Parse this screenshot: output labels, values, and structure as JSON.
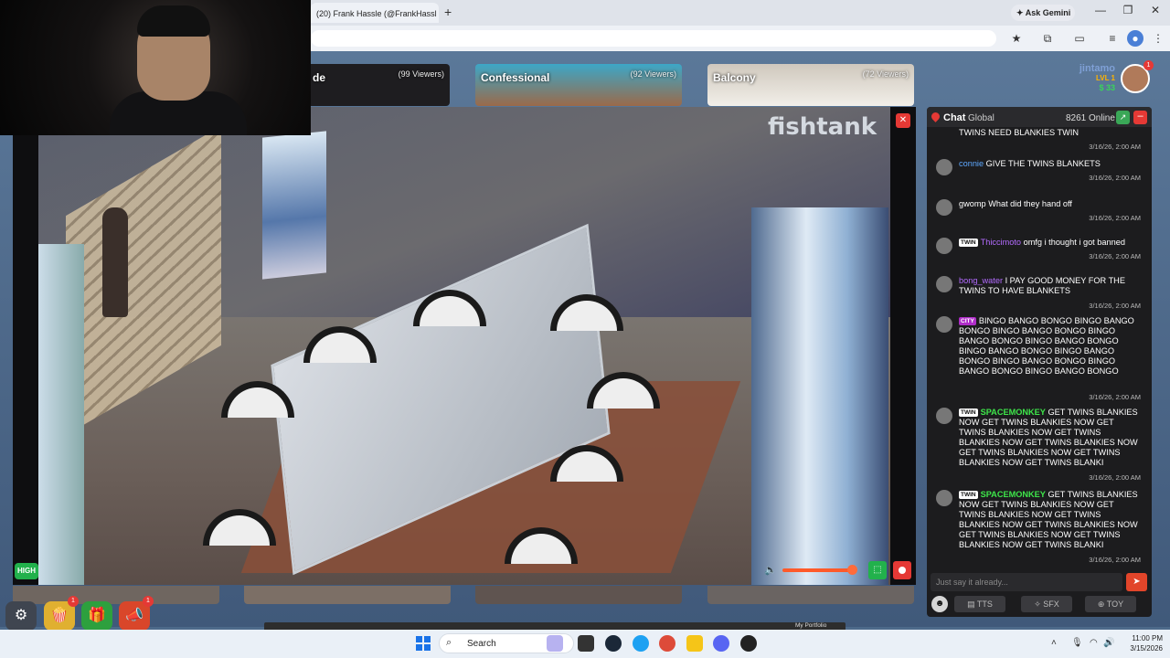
{
  "browser": {
    "tab_title": "(20) Frank Hassle (@FrankHassl",
    "new_tab": "+",
    "ask_gemini": "Ask Gemini",
    "min": "—",
    "restore": "❐",
    "close": "✕"
  },
  "rooms": [
    {
      "name": "de",
      "viewers": "(99 Viewers)"
    },
    {
      "name": "Confessional",
      "viewers": "(92 Viewers)"
    },
    {
      "name": "Balcony",
      "viewers": "(72 Viewers)"
    }
  ],
  "user": {
    "name": "jintamo",
    "level": "LVL 1",
    "coins": "$ 33",
    "badge": "1"
  },
  "video": {
    "watermark": "fishtank",
    "close": "✕",
    "quality": "HIGH",
    "volume_fraction": 0.95
  },
  "bottom_buttons": [
    {
      "icon": "gear-icon",
      "badge": ""
    },
    {
      "icon": "popcorn-icon",
      "badge": "1"
    },
    {
      "icon": "gift-icon",
      "badge": ""
    },
    {
      "icon": "megaphone-icon",
      "badge": "1"
    }
  ],
  "chat": {
    "title": "Chat",
    "scope": "Global",
    "online": "8261 Online",
    "input_placeholder": "Just say it already...",
    "buttons": {
      "tts": "TTS",
      "sfx": "SFX",
      "toy": "TOY"
    },
    "messages": [
      {
        "user": "",
        "tag": "",
        "text": "TWINS NEED BLANKIES TWIN",
        "time": "3/16/26, 2:00 AM",
        "color": "white"
      },
      {
        "user": "connie",
        "tag": "",
        "text": "GIVE THE TWINS BLANKETS",
        "time": "3/16/26, 2:00 AM",
        "color": "blue"
      },
      {
        "user": "gwomp",
        "tag": "",
        "text": "What did they hand off",
        "time": "3/16/26, 2:00 AM",
        "color": "white"
      },
      {
        "user": "Thiccimoto",
        "tag": "TWIN",
        "text": "omfg i thought i got banned",
        "time": "3/16/26, 2:00 AM",
        "color": "purple"
      },
      {
        "user": "bong_water",
        "tag": "",
        "text": "I PAY GOOD MONEY FOR THE TWINS TO HAVE BLANKETS",
        "time": "3/16/26, 2:00 AM",
        "color": "purple"
      },
      {
        "user": "",
        "tag": "CITY",
        "text": "BINGO BANGO BONGO BINGO BANGO BONGO BINGO BANGO BONGO BINGO BANGO BONGO BINGO BANGO BONGO BINGO BANGO BONGO BINGO BANGO BONGO BINGO BANGO BONGO BINGO BANGO BONGO BINGO BANGO BONGO",
        "time": "3/16/26, 2:00 AM",
        "color": "red"
      },
      {
        "user": "SPACEMONKEY",
        "tag": "TWIN",
        "text": "GET TWINS BLANKIES NOW GET TWINS BLANKIES NOW GET TWINS BLANKIES NOW GET TWINS BLANKIES NOW GET TWINS BLANKIES NOW GET TWINS BLANKIES NOW GET TWINS BLANKIES NOW GET TWINS BLANKI",
        "time": "3/16/26, 2:00 AM",
        "color": "green"
      },
      {
        "user": "SPACEMONKEY",
        "tag": "TWIN",
        "text": "GET TWINS BLANKIES NOW GET TWINS BLANKIES NOW GET TWINS BLANKIES NOW GET TWINS BLANKIES NOW GET TWINS BLANKIES NOW GET TWINS BLANKIES NOW GET TWINS BLANKIES NOW GET TWINS BLANKI",
        "time": "3/16/26, 2:00 AM",
        "color": "green"
      }
    ]
  },
  "portfolio": "My Portfolio",
  "taskbar": {
    "search": "Search",
    "time": "11:00 PM",
    "date": "3/15/2026"
  },
  "colors": {
    "accent_red": "#e53935",
    "accent_green": "#22b14c",
    "chat_bg": "#1c1c1e"
  }
}
